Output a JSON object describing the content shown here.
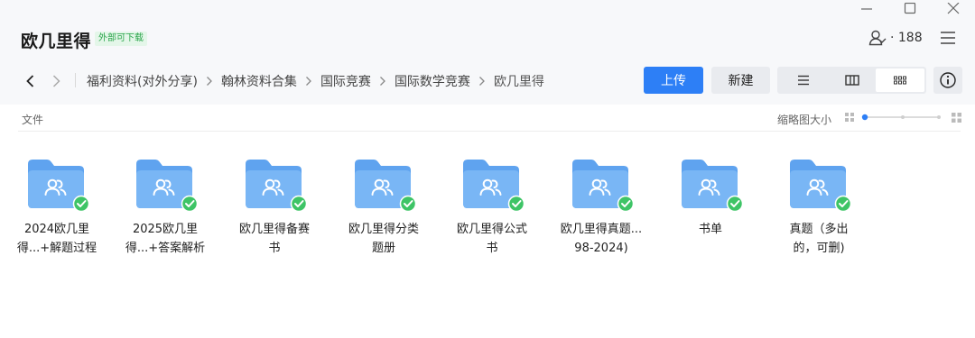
{
  "header": {
    "title": "欧几里得",
    "badge": "外部可下载",
    "member_count": "· 188"
  },
  "breadcrumb": {
    "items": [
      "福利资料(对外分享)",
      "翰林资料合集",
      "国际竞赛",
      "国际数学竞赛",
      "欧几里得"
    ]
  },
  "toolbar": {
    "upload_label": "上传",
    "new_label": "新建"
  },
  "list": {
    "column_label": "文件",
    "size_label": "缩略图大小",
    "thumbnail_size_level": 0
  },
  "files": [
    {
      "name_line1": "2024欧几里",
      "name_line2": "得...+解题过程",
      "icon": "shared-folder-icon",
      "status": "synced"
    },
    {
      "name_line1": "2025欧几里",
      "name_line2": "得...+答案解析",
      "icon": "shared-folder-icon",
      "status": "synced"
    },
    {
      "name_line1": "欧几里得备赛",
      "name_line2": "书",
      "icon": "shared-folder-icon",
      "status": "synced"
    },
    {
      "name_line1": "欧几里得分类",
      "name_line2": "题册",
      "icon": "shared-folder-icon",
      "status": "synced"
    },
    {
      "name_line1": "欧几里得公式",
      "name_line2": "书",
      "icon": "shared-folder-icon",
      "status": "synced"
    },
    {
      "name_line1": "欧几里得真题...",
      "name_line2": "98-2024)",
      "icon": "shared-folder-icon",
      "status": "synced"
    },
    {
      "name_line1": "书单",
      "name_line2": "",
      "icon": "shared-folder-icon",
      "status": "synced"
    },
    {
      "name_line1": "真题（多出",
      "name_line2": "的，可删)",
      "icon": "shared-folder-icon",
      "status": "synced"
    }
  ],
  "colors": {
    "accent": "#2d7ff6",
    "folder_back": "#5fa3ef",
    "folder_front": "#79b6f5",
    "synced_badge": "#3ec466",
    "badge_text": "#2aa54a"
  }
}
